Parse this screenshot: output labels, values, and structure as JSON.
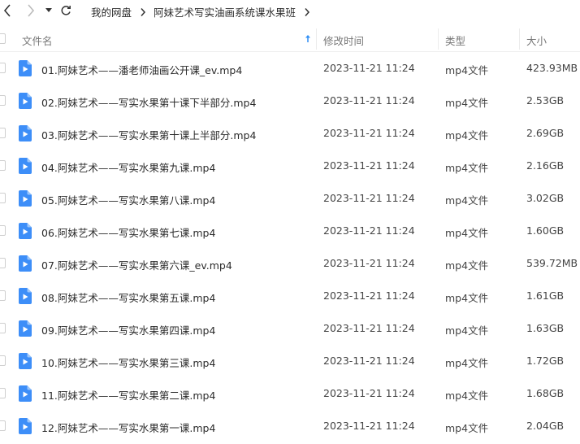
{
  "nav": {
    "back_icon": "chevron-left-icon",
    "forward_icon": "chevron-right-icon",
    "history_icon": "caret-down-icon",
    "refresh_icon": "refresh-icon"
  },
  "breadcrumb": [
    "我的网盘",
    "阿妹艺术写实油画系统课水果班"
  ],
  "columns": {
    "name": "文件名",
    "date": "修改时间",
    "type": "类型",
    "size": "大小",
    "sort_icon": "sort-ascending-arrow-icon"
  },
  "colors": {
    "accent": "#2f8ef4",
    "file_icon": "#3d8ef8"
  },
  "files": [
    {
      "name": "01.阿妹艺术——潘老师油画公开课_ev.mp4",
      "date": "2023-11-21 11:24",
      "type": "mp4文件",
      "size": "423.93MB"
    },
    {
      "name": "02.阿妹艺术——写实水果第十课下半部分.mp4",
      "date": "2023-11-21 11:24",
      "type": "mp4文件",
      "size": "2.53GB"
    },
    {
      "name": "03.阿妹艺术——写实水果第十课上半部分.mp4",
      "date": "2023-11-21 11:24",
      "type": "mp4文件",
      "size": "2.69GB"
    },
    {
      "name": "04.阿妹艺术——写实水果第九课.mp4",
      "date": "2023-11-21 11:24",
      "type": "mp4文件",
      "size": "2.16GB"
    },
    {
      "name": "05.阿妹艺术——写实水果第八课.mp4",
      "date": "2023-11-21 11:24",
      "type": "mp4文件",
      "size": "3.02GB"
    },
    {
      "name": "06.阿妹艺术——写实水果第七课.mp4",
      "date": "2023-11-21 11:24",
      "type": "mp4文件",
      "size": "1.60GB"
    },
    {
      "name": "07.阿妹艺术——写实水果第六课_ev.mp4",
      "date": "2023-11-21 11:24",
      "type": "mp4文件",
      "size": "539.72MB"
    },
    {
      "name": "08.阿妹艺术——写实水果第五课.mp4",
      "date": "2023-11-21 11:24",
      "type": "mp4文件",
      "size": "1.61GB"
    },
    {
      "name": "09.阿妹艺术——写实水果第四课.mp4",
      "date": "2023-11-21 11:24",
      "type": "mp4文件",
      "size": "1.63GB"
    },
    {
      "name": "10.阿妹艺术——写实水果第三课.mp4",
      "date": "2023-11-21 11:24",
      "type": "mp4文件",
      "size": "1.72GB"
    },
    {
      "name": "11.阿妹艺术——写实水果第二课.mp4",
      "date": "2023-11-21 11:24",
      "type": "mp4文件",
      "size": "1.68GB"
    },
    {
      "name": "12.阿妹艺术——写实水果第一课.mp4",
      "date": "2023-11-21 11:24",
      "type": "mp4文件",
      "size": "2.04GB"
    }
  ]
}
